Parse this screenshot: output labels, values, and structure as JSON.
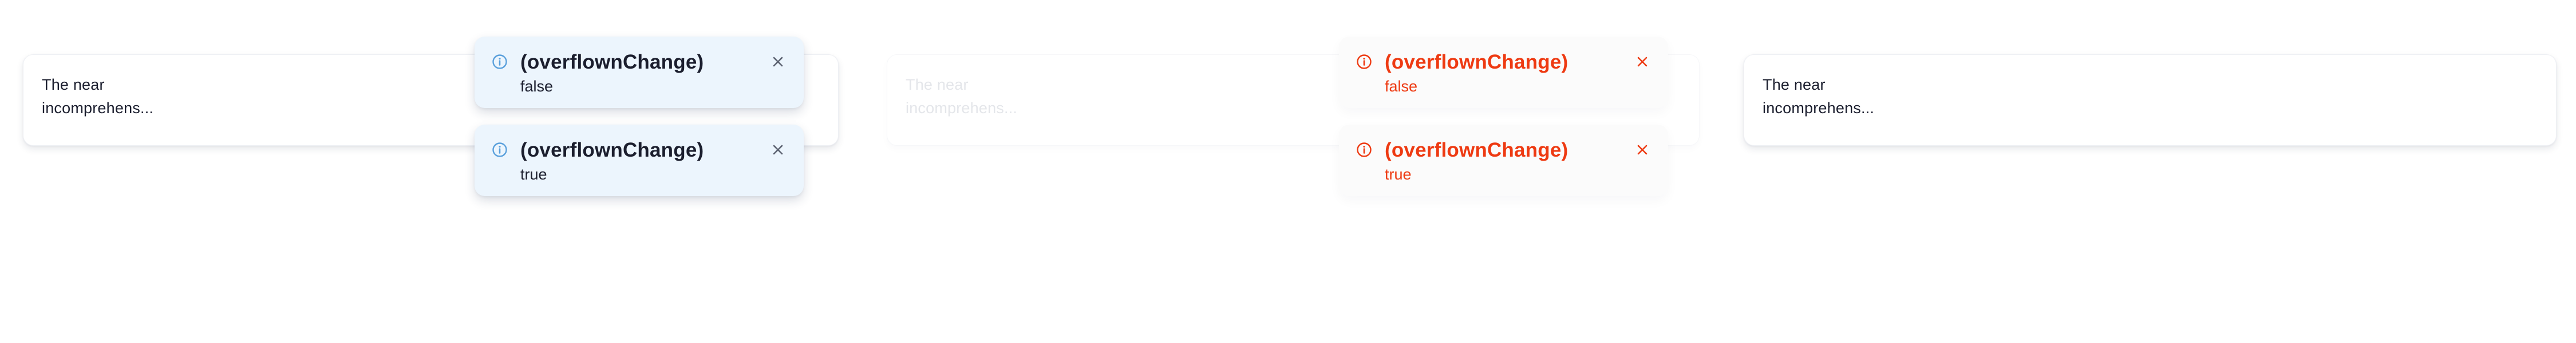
{
  "colors": {
    "text": "#1b1e2e",
    "info_icon": "#5aa0dc",
    "info_bg": "#ecf5fd",
    "close_icon": "#5b6170",
    "error": "#ee3a12",
    "faded_text": "#e4e6ea"
  },
  "cards": [
    {
      "text": "The near incomprehens..."
    },
    {
      "text": "The near incomprehens..."
    },
    {
      "text": "The near incomprehens..."
    }
  ],
  "toasts": [
    {
      "variant": "info",
      "icon": "info-circle-icon",
      "title": "(overflownChange)",
      "value": "false"
    },
    {
      "variant": "info",
      "icon": "info-circle-icon",
      "title": "(overflownChange)",
      "value": "true"
    },
    {
      "variant": "error",
      "icon": "info-circle-icon",
      "title": "(overflownChange)",
      "value": "false"
    },
    {
      "variant": "error",
      "icon": "info-circle-icon",
      "title": "(overflownChange)",
      "value": "true"
    }
  ]
}
